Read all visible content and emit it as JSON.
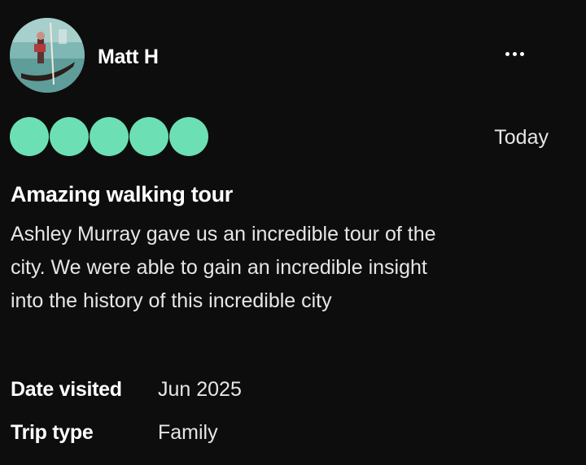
{
  "review": {
    "reviewer": {
      "name": "Matt H",
      "avatar_icon": "gondola-photo"
    },
    "more_icon": "more-options-icon",
    "rating": {
      "value": 5,
      "max": 5,
      "filled_color": "#6ce0b4"
    },
    "date": "Today",
    "title": "Amazing walking tour",
    "body_lines": [
      "Ashley Murray gave us an incredible tour of the",
      "city. We were able to gain an incredible insight",
      "into the history of this incredible city"
    ],
    "details": {
      "date_visited_label": "Date visited",
      "date_visited_value": "Jun 2025",
      "trip_type_label": "Trip type",
      "trip_type_value": "Family"
    }
  },
  "colors": {
    "background": "#0d0d0d",
    "text": "#ffffff",
    "secondary_text": "#e6e6e6",
    "rating": "#6ce0b4"
  }
}
